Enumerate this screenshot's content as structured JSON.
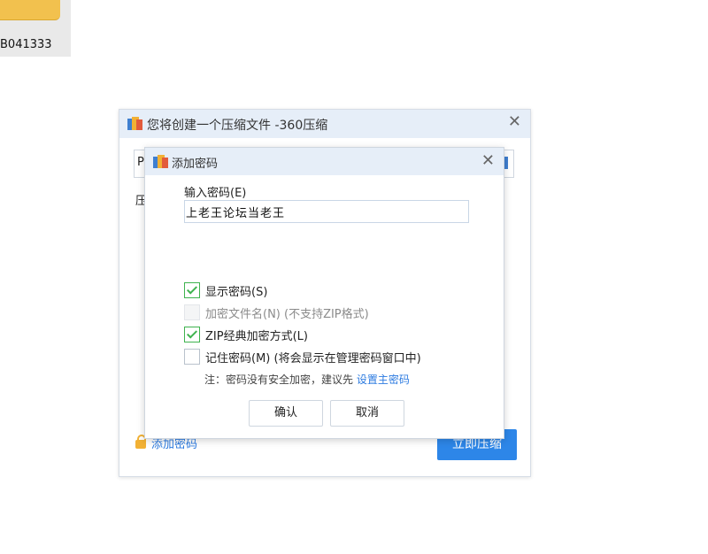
{
  "desktop": {
    "item_label": "B041333"
  },
  "outer_dialog": {
    "title": "您将创建一个压缩文件 -360压缩",
    "path_field_value": "P",
    "field_label": "压",
    "add_password_link": "添加密码",
    "compress_button": "立即压缩"
  },
  "password_dialog": {
    "title": "添加密码",
    "input_label": "输入密码(E)",
    "input_value": "上老王论坛当老王",
    "options": [
      {
        "label": "显示密码(S)",
        "checked": true,
        "enabled": true
      },
      {
        "label": "加密文件名(N) (不支持ZIP格式)",
        "checked": false,
        "enabled": false
      },
      {
        "label": "ZIP经典加密方式(L)",
        "checked": true,
        "enabled": true
      },
      {
        "label": "记住密码(M) (将会显示在管理密码窗口中)",
        "checked": false,
        "enabled": true
      }
    ],
    "note_text": "注：密码没有安全加密，建议先 ",
    "note_link": "设置主密码",
    "ok_button": "确认",
    "cancel_button": "取消"
  },
  "icons": {
    "close": "close-icon",
    "app": "360-zip-icon",
    "lock": "lock-icon"
  },
  "colors": {
    "accent": "#2d86e8",
    "title_bar": "#e6eef8",
    "check_green": "#3fb34f",
    "link": "#2d7be0"
  }
}
